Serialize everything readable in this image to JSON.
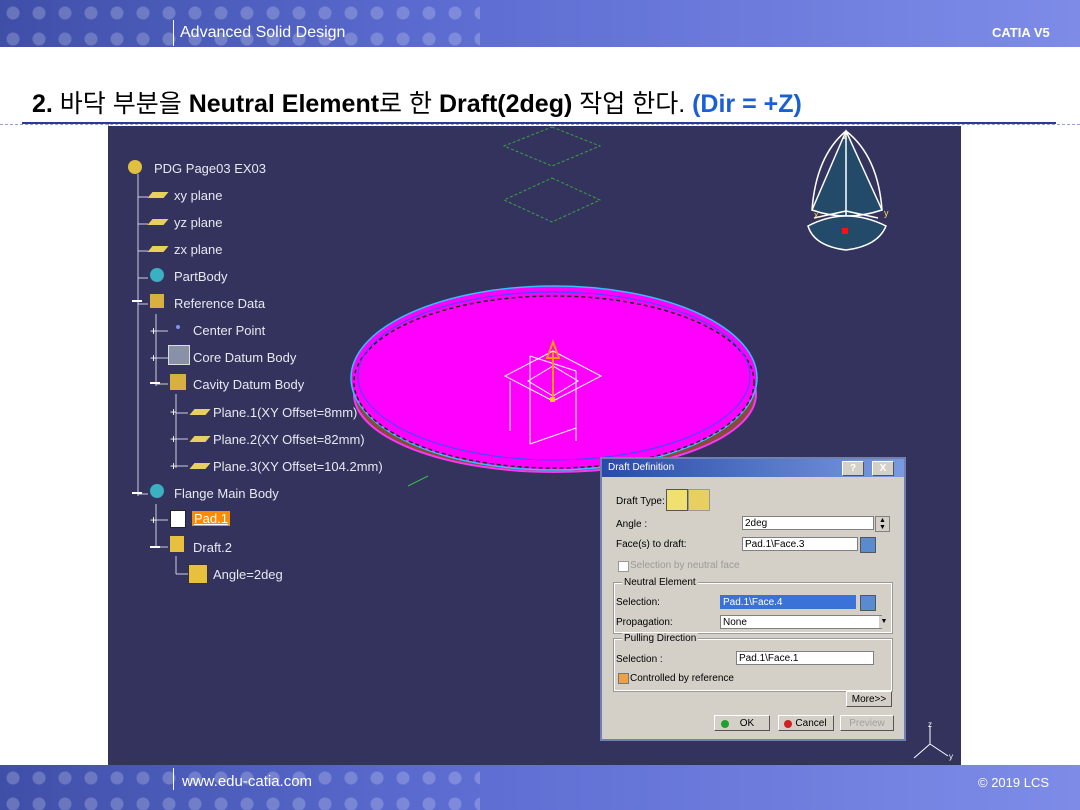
{
  "header": {
    "course": "Advanced Solid Design",
    "product": "CATIA V5"
  },
  "footer": {
    "website": "www.edu-catia.com",
    "copyright": "© 2019 LCS"
  },
  "slide": {
    "title_num": "2.",
    "title_a": " 바닥 부분을 ",
    "title_b": "Neutral Element",
    "title_c": "로 한 ",
    "title_d": "Draft(2deg)",
    "title_e": " 작업 한다. ",
    "title_dir": "(Dir = +Z)"
  },
  "tree": {
    "root": "PDG Page03 EX03",
    "xy": "xy plane",
    "yz": "yz plane",
    "zx": "zx plane",
    "partbody": "PartBody",
    "refdata": "Reference Data",
    "center": "Center Point",
    "core": "Core Datum Body",
    "cavity": "Cavity Datum Body",
    "plane1": "Plane.1(XY Offset=8mm)",
    "plane2": "Plane.2(XY Offset=82mm)",
    "plane3": "Plane.3(XY Offset=104.2mm)",
    "flange": "Flange Main Body",
    "pad": "Pad.1",
    "draft": "Draft.2",
    "angle": "Angle=2deg"
  },
  "compass": {
    "z": "z",
    "x": "x",
    "y": "y"
  },
  "axis": {
    "z": "z",
    "y": "y"
  },
  "dialog": {
    "title": "Draft Definition",
    "help": "?",
    "close": "X",
    "draft_type_label": "Draft Type:",
    "angle_label": "Angle :",
    "angle_value": "2deg",
    "faces_label": "Face(s) to draft:",
    "faces_value": "Pad.1\\Face.3",
    "sel_neutral": "Selection by neutral face",
    "neutral_group": "Neutral Element",
    "sel_label": "Selection:",
    "neutral_value": "Pad.1\\Face.4",
    "prop_label": "Propagation:",
    "prop_value": "None",
    "pulling_group": "Pulling Direction",
    "pull_sel_label": "Selection :",
    "pull_value": "Pad.1\\Face.1",
    "controlled": "Controlled by reference",
    "more": "More>>",
    "ok": "OK",
    "cancel": "Cancel",
    "preview": "Preview"
  }
}
